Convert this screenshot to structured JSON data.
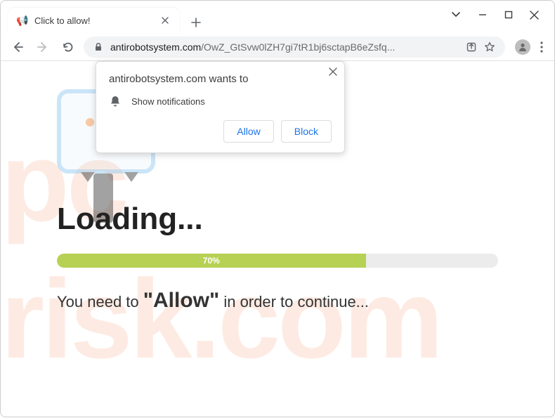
{
  "window": {
    "tab_title": "Click to allow!"
  },
  "toolbar": {
    "url_host": "antirobotsystem.com",
    "url_path": "/OwZ_GtSvw0lZH7gi7tR1bj6sctapB6eZsfq..."
  },
  "popup": {
    "headline": "antirobotsystem.com wants to",
    "message": "Show notifications",
    "allow_label": "Allow",
    "block_label": "Block"
  },
  "page": {
    "loading_label": "Loading...",
    "progress_percent": "70%",
    "progress_width": "70%",
    "instruction_before": "You need to ",
    "instruction_quoted": "\"Allow\"",
    "instruction_after": " in order to continue..."
  },
  "watermark": {
    "line1": "pc",
    "line2": "risk.com"
  }
}
